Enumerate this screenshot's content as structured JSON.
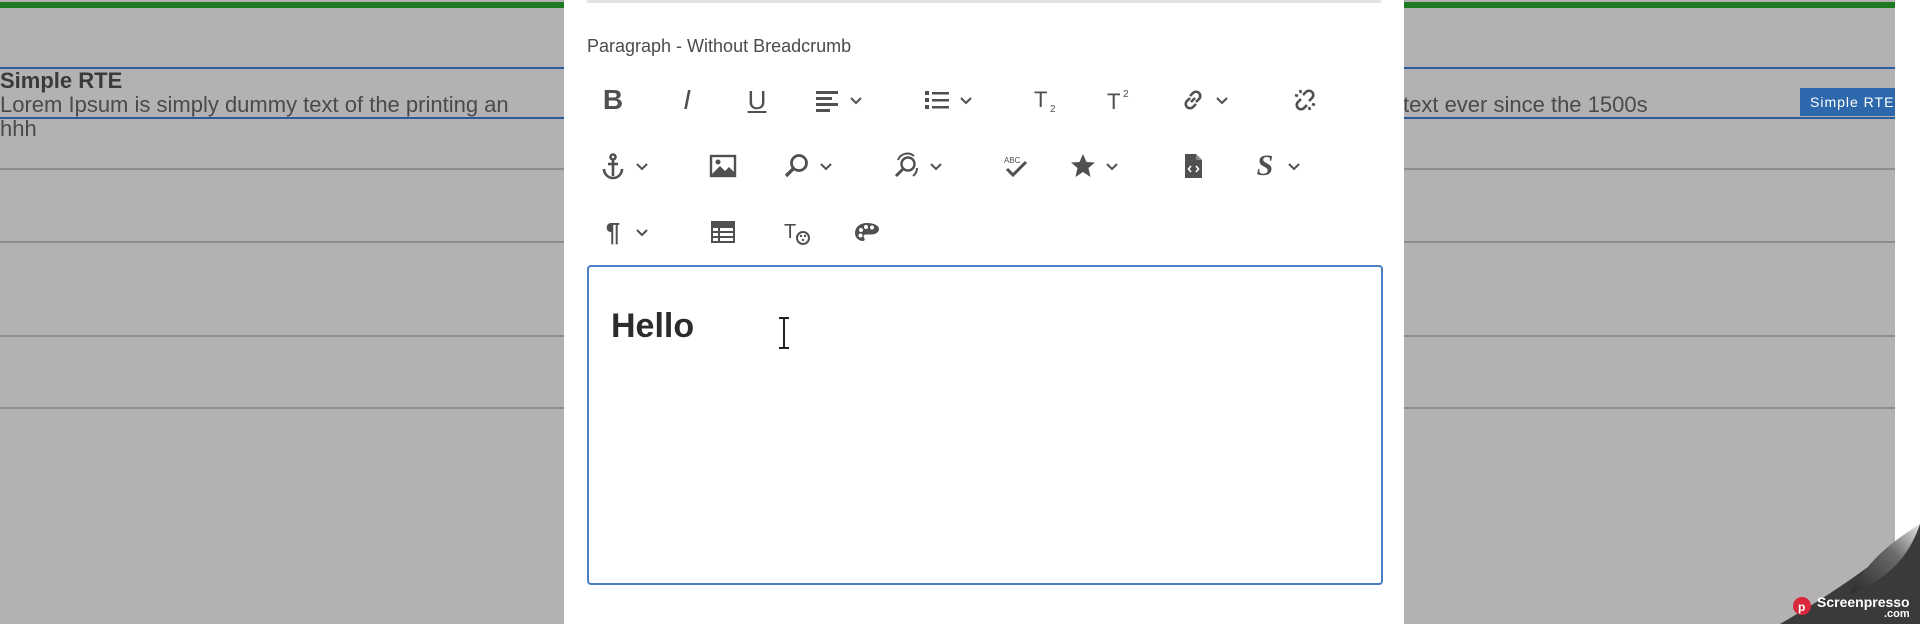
{
  "background": {
    "title": "Simple RTE",
    "text_left": "Lorem Ipsum is simply dummy text of the printing an",
    "text_right": "text ever since the 1500s",
    "text_line2": "hhh",
    "badge": "Simple RTE"
  },
  "dialog": {
    "label": "Paragraph - Without Breadcrumb",
    "toolbar": {
      "row1": [
        "bold-icon",
        "italic-icon",
        "underline-icon",
        "align-icon",
        "list-icon",
        "subscript-icon",
        "superscript-icon",
        "link-icon",
        "unlink-icon"
      ],
      "row2": [
        "anchor-icon",
        "image-icon",
        "find-icon",
        "find-replace-icon",
        "spellcheck-icon",
        "special-char-icon",
        "source-edit-icon",
        "styles-icon"
      ],
      "row3": [
        "paragraph-format-icon",
        "table-icon",
        "text-styles-icon",
        "colors-icon"
      ]
    },
    "editor": {
      "content": "Hello"
    }
  },
  "watermark": {
    "text": "Screenpresso",
    "suffix": ".com"
  },
  "colors": {
    "accent": "#2d68ad",
    "editor_border": "#4b7ec7",
    "green_bar": "#1f7a1f",
    "overlay": "#b3b1b4"
  }
}
